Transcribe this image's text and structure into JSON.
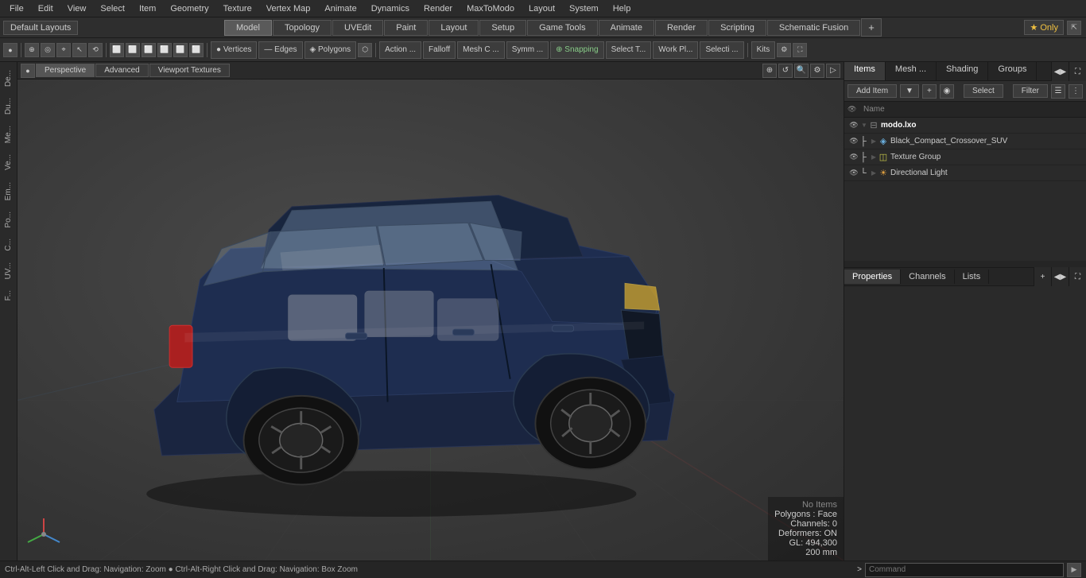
{
  "menubar": {
    "items": [
      "File",
      "Edit",
      "View",
      "Select",
      "Item",
      "Geometry",
      "Texture",
      "Vertex Map",
      "Animate",
      "Dynamics",
      "Render",
      "MaxToModo",
      "Layout",
      "System",
      "Help"
    ]
  },
  "layoutbar": {
    "dropdown": "Default Layouts",
    "tabs": [
      "Model",
      "Topology",
      "UVEdit",
      "Paint",
      "Layout",
      "Setup",
      "Game Tools",
      "Animate",
      "Render",
      "Scripting",
      "Schematic Fusion"
    ],
    "active_tab": "Model",
    "plus": "+",
    "star_label": "Only"
  },
  "toolbar": {
    "groups": [
      {
        "items": [
          "●"
        ]
      },
      {
        "items": [
          "⊕",
          "◎",
          "⌖",
          "↖",
          "⟲"
        ]
      },
      {
        "items": [
          "⬜",
          "⬜",
          "⬜",
          "⬜",
          "⬜",
          "⬜"
        ]
      },
      {
        "items": [
          "● Vertices",
          "— Edges",
          "◈ Polygons",
          "⬡"
        ]
      },
      {
        "items": [
          "Action ...",
          "Falloff",
          "Mesh C ...",
          "Symm ...",
          "⊕ Snapping",
          "Select T...",
          "Work Pl...",
          "Selecti ...",
          "Kits"
        ]
      }
    ]
  },
  "leftsidebar": {
    "tabs": [
      "De...",
      "Du...",
      "Me...",
      "Ve...",
      "Em...",
      "Po...",
      "C...",
      "UV...",
      "F..."
    ]
  },
  "viewport": {
    "tabs": [
      "Perspective",
      "Advanced",
      "Viewport Textures"
    ],
    "active_tab": "Perspective",
    "info": {
      "no_items": "No Items",
      "polygons": "Polygons : Face",
      "channels": "Channels: 0",
      "deformers": "Deformers: ON",
      "gl": "GL: 494,300",
      "zoom": "200 mm"
    }
  },
  "statusbar": {
    "message": "Ctrl-Alt-Left Click and Drag: Navigation: Zoom ● Ctrl-Alt-Right Click and Drag: Navigation: Box Zoom",
    "command_arrow": ">",
    "command_placeholder": "Command"
  },
  "rightpanel": {
    "item_tabs": [
      "Items",
      "Mesh ...",
      "Shading",
      "Groups"
    ],
    "active_item_tab": "Items",
    "add_item_label": "Add Item",
    "select_label": "Select",
    "filter_label": "Filter",
    "name_col": "Name",
    "items_tree": [
      {
        "id": 1,
        "level": 0,
        "name": "modo.lxo",
        "icon": "scene",
        "expanded": true,
        "vis": true
      },
      {
        "id": 2,
        "level": 1,
        "name": "Black_Compact_Crossover_SUV",
        "icon": "mesh",
        "expanded": false,
        "vis": true
      },
      {
        "id": 3,
        "level": 1,
        "name": "Texture Group",
        "icon": "texture",
        "expanded": false,
        "vis": true
      },
      {
        "id": 4,
        "level": 1,
        "name": "Directional Light",
        "icon": "light",
        "expanded": false,
        "vis": true
      }
    ],
    "properties_tabs": [
      "Properties",
      "Channels",
      "Lists"
    ],
    "active_props_tab": "Properties"
  }
}
